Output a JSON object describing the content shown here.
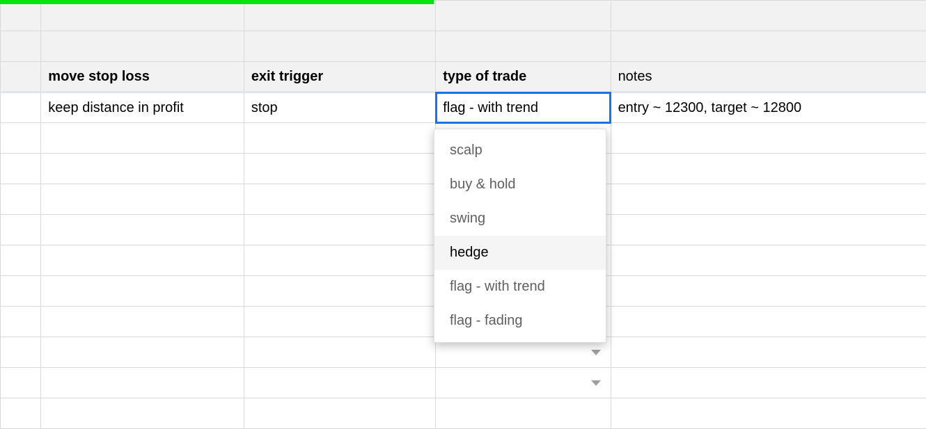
{
  "headers": {
    "col_b": "move stop loss",
    "col_c": "exit trigger",
    "col_d": "type of trade",
    "col_e": "notes"
  },
  "row1": {
    "move_stop_loss": "keep distance in profit",
    "exit_trigger": "stop",
    "type_of_trade": "flag - with trend",
    "notes": "entry ~ 12300, target ~ 12800"
  },
  "dropdown": {
    "options": [
      {
        "label": "scalp",
        "highlight": false
      },
      {
        "label": "buy & hold",
        "highlight": false
      },
      {
        "label": "swing",
        "highlight": false
      },
      {
        "label": "hedge",
        "highlight": true
      },
      {
        "label": "flag - with trend",
        "highlight": false
      },
      {
        "label": "flag - fading",
        "highlight": false
      }
    ]
  }
}
